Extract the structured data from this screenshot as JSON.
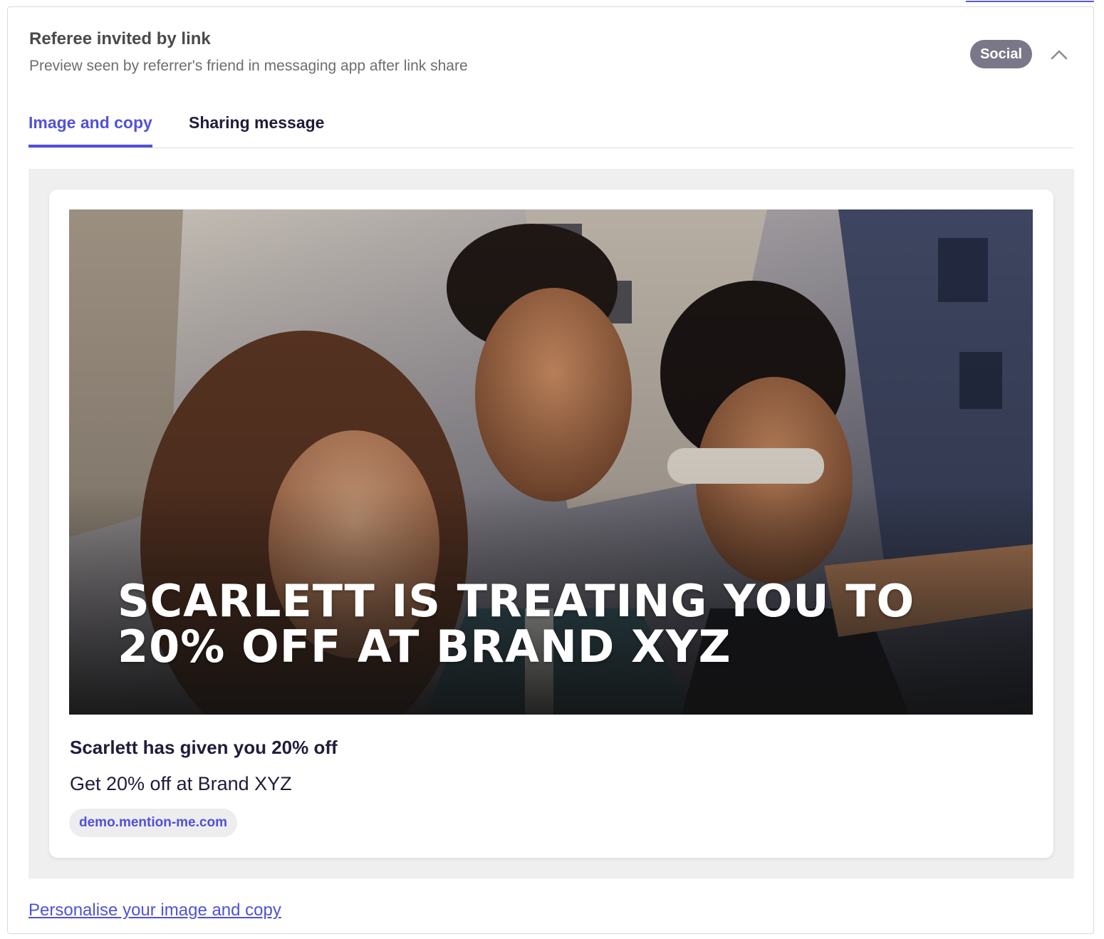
{
  "section": {
    "title": "Referee invited by link",
    "subtitle": "Preview seen by referrer's friend in messaging app after link share",
    "badge": "Social",
    "collapse_icon": "chevron-up-icon"
  },
  "tabs": [
    {
      "label": "Image and copy",
      "active": true
    },
    {
      "label": "Sharing message",
      "active": false
    }
  ],
  "preview": {
    "image_overlay_line1": "SCARLETT IS TREATING YOU TO",
    "image_overlay_line2": "20% OFF AT BRAND XYZ",
    "title": "Scarlett has given you 20% off",
    "description": "Get 20% off at Brand XYZ",
    "domain": "demo.mention-me.com"
  },
  "footer": {
    "link_label": "Personalise your image and copy"
  },
  "colors": {
    "accent": "#5151d9",
    "badge_bg": "#7a7888",
    "preview_bg": "#efefef"
  }
}
